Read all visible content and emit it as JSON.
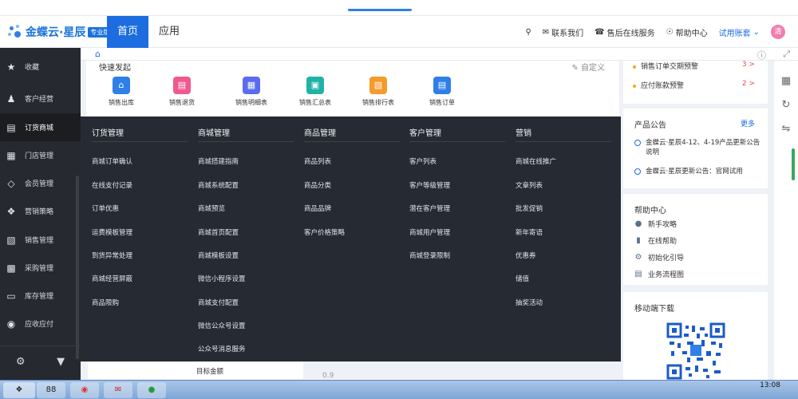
{
  "header": {
    "brand": "金蝶云·星辰",
    "edition": "专业版",
    "tabs": [
      {
        "label": "首页",
        "active": true
      },
      {
        "label": "应用",
        "active": false
      }
    ],
    "links": [
      "联系我们",
      "售后在线服务",
      "帮助中心"
    ],
    "account": "试用账套",
    "avatar_text": "清"
  },
  "sidebar": {
    "items": [
      {
        "label": "收藏",
        "icon": "star-icon"
      },
      {
        "label": "客户经营",
        "icon": "user-icon"
      },
      {
        "label": "订货商城",
        "icon": "cart-box-icon",
        "active": true
      },
      {
        "label": "门店管理",
        "icon": "store-icon"
      },
      {
        "label": "会员管理",
        "icon": "diamond-icon"
      },
      {
        "label": "营销策略",
        "icon": "tag-icon"
      },
      {
        "label": "销售管理",
        "icon": "bar-chart-icon"
      },
      {
        "label": "采购管理",
        "icon": "cart-icon"
      },
      {
        "label": "库存管理",
        "icon": "box-icon"
      },
      {
        "label": "应收应付",
        "icon": "coin-icon"
      }
    ]
  },
  "quick": {
    "title": "快速发起",
    "edit": "自定义",
    "items": [
      {
        "label": "销售出库",
        "color": "#2f7fe8",
        "icon": "house-icon"
      },
      {
        "label": "销售退货",
        "color": "#ee5a8e",
        "icon": "return-box-icon"
      },
      {
        "label": "销售明细表",
        "color": "#5a6cf0",
        "icon": "table-icon"
      },
      {
        "label": "销售汇总表",
        "color": "#1fb3a4",
        "icon": "summary-icon"
      },
      {
        "label": "销售排行表",
        "color": "#f59a2c",
        "icon": "rank-icon"
      },
      {
        "label": "销售订单",
        "color": "#2f7fe8",
        "icon": "order-icon"
      }
    ]
  },
  "mega_menu": {
    "columns": [
      {
        "title": "订货管理",
        "links": [
          "商城订单确认",
          "在线支付记录",
          "订单优惠",
          "运费模板管理",
          "到货异常处理",
          "商城经营屏蔽",
          "商品限购"
        ]
      },
      {
        "title": "商城管理",
        "links": [
          "商城搭建指南",
          "商城系统配置",
          "商城预览",
          "商城首页配置",
          "商城模板设置",
          "微信小程序设置",
          "商城支付配置",
          "微信公众号设置",
          "公众号消息服务"
        ]
      },
      {
        "title": "商品管理",
        "links": [
          "商品列表",
          "商品分类",
          "商品品牌",
          "客户价格策略"
        ]
      },
      {
        "title": "客户管理",
        "links": [
          "客户列表",
          "客户等级管理",
          "潜在客户管理",
          "商城用户管理",
          "商城登录限制"
        ]
      },
      {
        "title": "营销",
        "links": [
          "商城在线推广",
          "文章列表",
          "批发促销",
          "新年寄语",
          "优惠券",
          "储值",
          "抽奖活动"
        ]
      }
    ],
    "footer_label": "目标金额",
    "footer_number": "0.9"
  },
  "warnings": [
    {
      "label": "销售订单交期预警",
      "count": "3"
    },
    {
      "label": "应付账款预警",
      "count": "2"
    }
  ],
  "notice": {
    "title": "产品公告",
    "more": "更多",
    "items": [
      "金蝶云·星辰4-12、4-19产品更新公告说明",
      "金蝶云·星辰更新公告：官网试用"
    ]
  },
  "help": {
    "title": "帮助中心",
    "items": [
      {
        "label": "新手攻略",
        "icon": "chat-icon"
      },
      {
        "label": "在线帮助",
        "icon": "doc-icon"
      },
      {
        "label": "初始化引导",
        "icon": "gear-icon"
      },
      {
        "label": "业务流程图",
        "icon": "flow-icon"
      }
    ]
  },
  "mobile": {
    "title": "移动端下载"
  },
  "taskbar": {
    "badge": "88",
    "time": "13:08"
  }
}
